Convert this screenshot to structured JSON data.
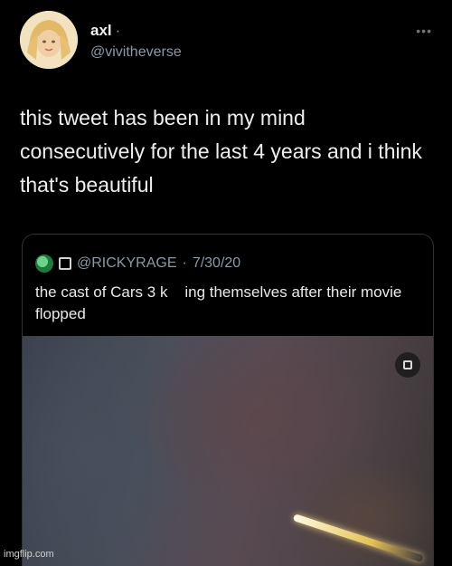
{
  "tweet": {
    "display_name": "axl",
    "name_separator": "·",
    "handle": "@vivitheverse",
    "more_icon": "more-dots-icon",
    "more_glyph": "•••",
    "text": "this tweet has been in my mind consecutively for the last 4 years and i think that's beautiful"
  },
  "quoted_tweet": {
    "handle": "@RICKYRAGE",
    "separator": "·",
    "date": "7/30/20",
    "text": "the cast of Cars 3 k    ing themselves after their movie flopped",
    "media_badge_icon": "media-grid-icon"
  },
  "watermark": "imgflip.com"
}
